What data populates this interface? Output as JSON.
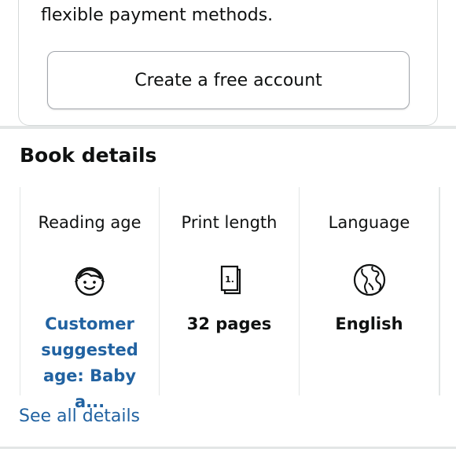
{
  "promo": {
    "text_line2": "flexible payment methods.",
    "create_account_label": "Create a free account"
  },
  "book_details": {
    "title": "Book details",
    "items": [
      {
        "label": "Reading age",
        "icon": "child-face-icon",
        "value": "Customer suggested age: Baby a...",
        "is_link": true
      },
      {
        "label": "Print length",
        "icon": "page-count-icon",
        "icon_text": "1.",
        "value": "32 pages",
        "is_link": false
      },
      {
        "label": "Language",
        "icon": "globe-icon",
        "value": "English",
        "is_link": false
      }
    ],
    "see_all_label": "See all details"
  },
  "colors": {
    "link": "#2162a1",
    "text": "#0f1111",
    "divider": "#e3e6e6"
  }
}
